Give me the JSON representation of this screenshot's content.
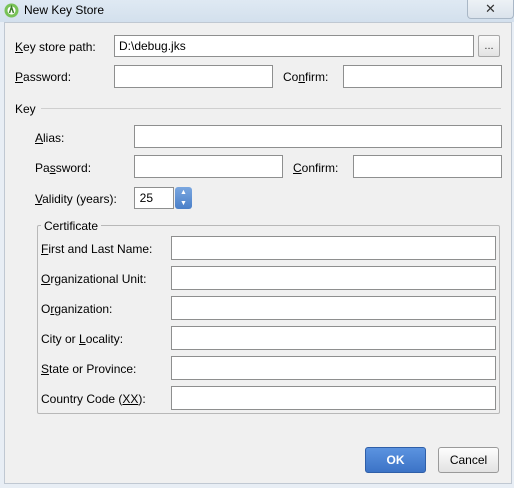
{
  "window": {
    "title": "New Key Store",
    "close_glyph": "✕"
  },
  "keystore": {
    "path_label_pre": "",
    "path_label_u": "K",
    "path_label_post": "ey store path:",
    "path_value": "D:\\debug.jks",
    "browse_label": "...",
    "password_label_pre": "",
    "password_label_u": "P",
    "password_label_post": "assword:",
    "password_value": "",
    "confirm_label_pre": "Co",
    "confirm_label_u": "n",
    "confirm_label_post": "firm:",
    "confirm_value": ""
  },
  "key": {
    "section_label": "Key",
    "alias_label_pre": "",
    "alias_label_u": "A",
    "alias_label_post": "lias:",
    "alias_value": "",
    "password_label_pre": "Pa",
    "password_label_u": "s",
    "password_label_post": "sword:",
    "password_value": "",
    "confirm_label_pre": "",
    "confirm_label_u": "C",
    "confirm_label_post": "onfirm:",
    "confirm_value": "",
    "validity_label_pre": "",
    "validity_label_u": "V",
    "validity_label_post": "alidity (years):",
    "validity_value": "25"
  },
  "certificate": {
    "title": "Certificate",
    "fields": [
      {
        "pre": "",
        "u": "F",
        "post": "irst and Last Name:",
        "value": ""
      },
      {
        "pre": "",
        "u": "O",
        "post": "rganizational Unit:",
        "value": ""
      },
      {
        "pre": "O",
        "u": "r",
        "post": "ganization:",
        "value": ""
      },
      {
        "pre": "City or ",
        "u": "L",
        "post": "ocality:",
        "value": ""
      },
      {
        "pre": "",
        "u": "S",
        "post": "tate or Province:",
        "value": ""
      },
      {
        "pre": "Country Code (",
        "u": "XX",
        "post": "):",
        "value": ""
      }
    ]
  },
  "buttons": {
    "ok": "OK",
    "cancel": "Cancel"
  },
  "colors": {
    "ok_button": "#3c73c6",
    "spinner": "#4a7fc8"
  }
}
